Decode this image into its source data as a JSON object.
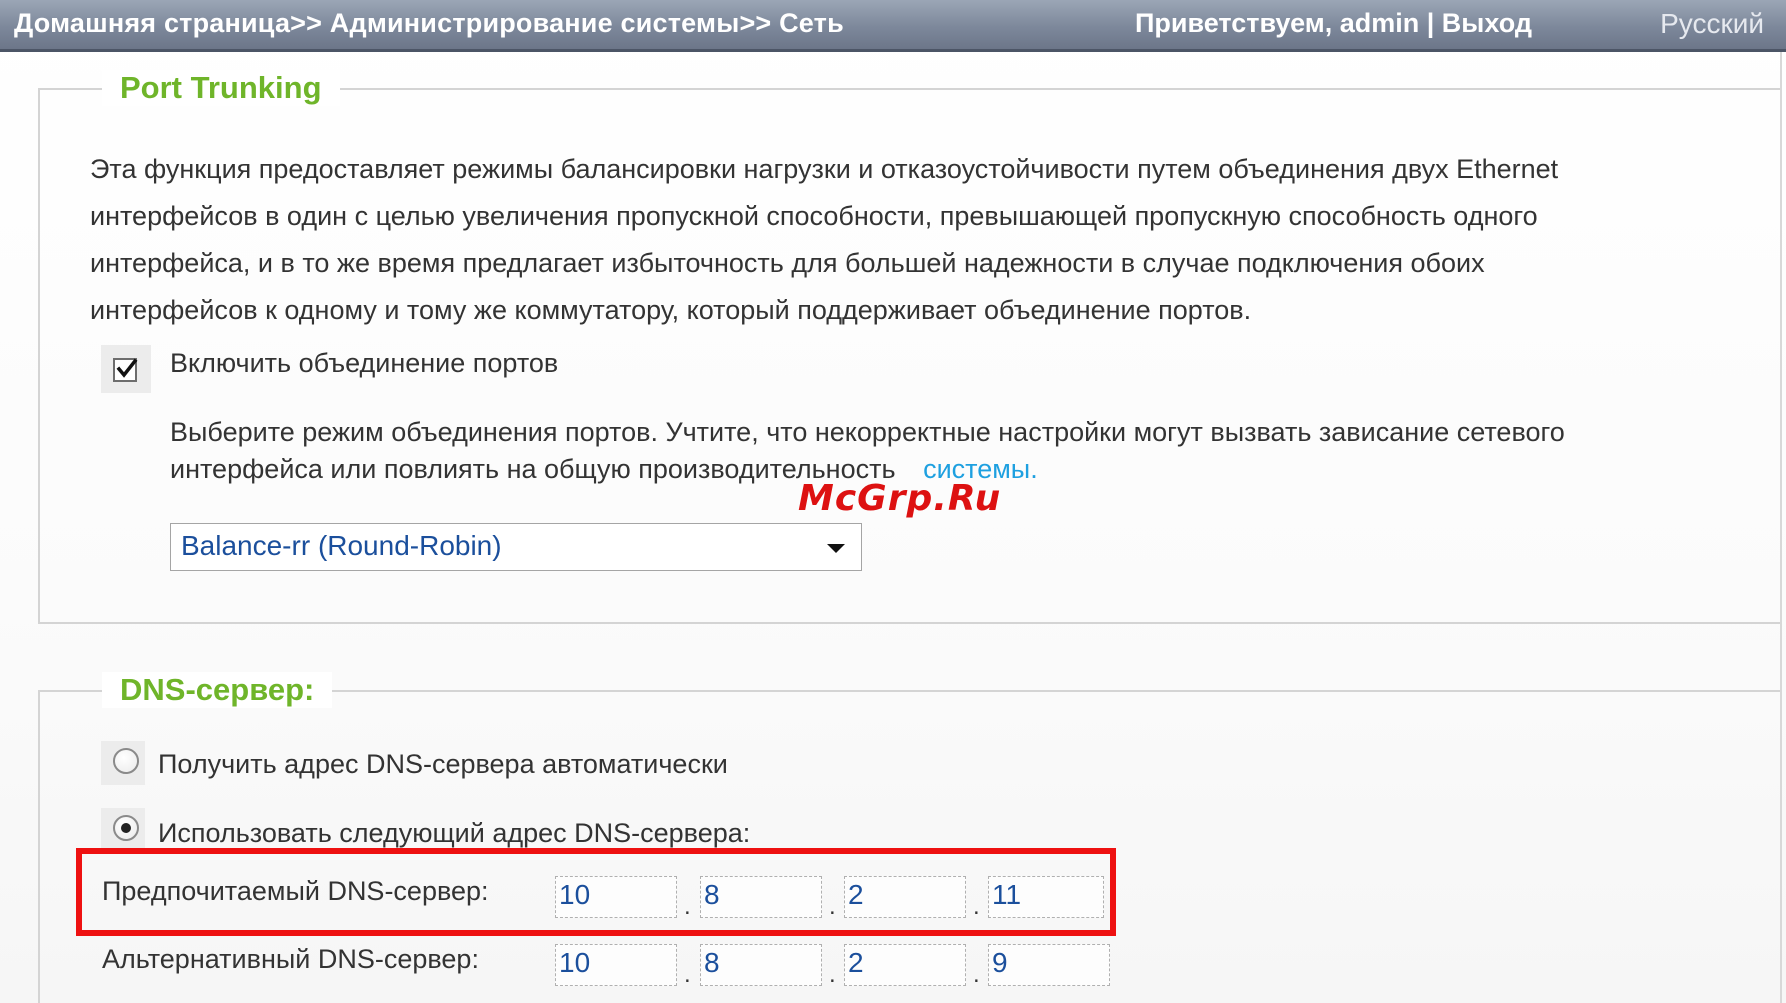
{
  "header": {
    "breadcrumb": "Домашняя страница>> Администрирование системы>> Сеть",
    "greeting": "Приветствуем, admin | Выход",
    "language": "Русский"
  },
  "port_trunking": {
    "title": "Port Trunking",
    "description_lines": [
      "Эта функция предоставляет режимы балансировки нагрузки и отказоустойчивости путем объединения двух Ethernet",
      "интерфейсов в один с целью увеличения пропускной способности, превышающей пропускную способность одного",
      "интерфейса, и в то же время предлагает избыточность для большей надежности в случае подключения обоих",
      "интерфейсов к одному и тому же коммутатору, который поддерживает объединение портов."
    ],
    "enable_label": "Включить объединение портов",
    "enable_checked": true,
    "mode_hint_line1": "Выберите режим объединения портов. Учтите, что некорректные настройки могут вызвать зависание сетевого",
    "mode_hint_line2": "интерфейса или повлиять на общую производительность",
    "mode_hint_link": "системы.",
    "mode_selected": "Balance-rr (Round-Robin)"
  },
  "dns": {
    "title": "DNS-сервер:",
    "auto_label": "Получить адрес DNS-сервера автоматически",
    "manual_label": "Использовать следующий адрес DNS-сервера:",
    "selected_option": "manual",
    "preferred_label": "Предпочитаемый DNS-сервер:",
    "preferred": [
      "10",
      "8",
      "2",
      "11"
    ],
    "alternate_label": "Альтернативный DNS-сервер:",
    "alternate": [
      "10",
      "8",
      "2",
      "9"
    ],
    "separator": "."
  },
  "watermark": "McGrp.Ru",
  "colors": {
    "legend": "#6fb52a",
    "link": "#1ea0e0",
    "highlight": "#ee1111",
    "input_text": "#1b4f9c"
  }
}
